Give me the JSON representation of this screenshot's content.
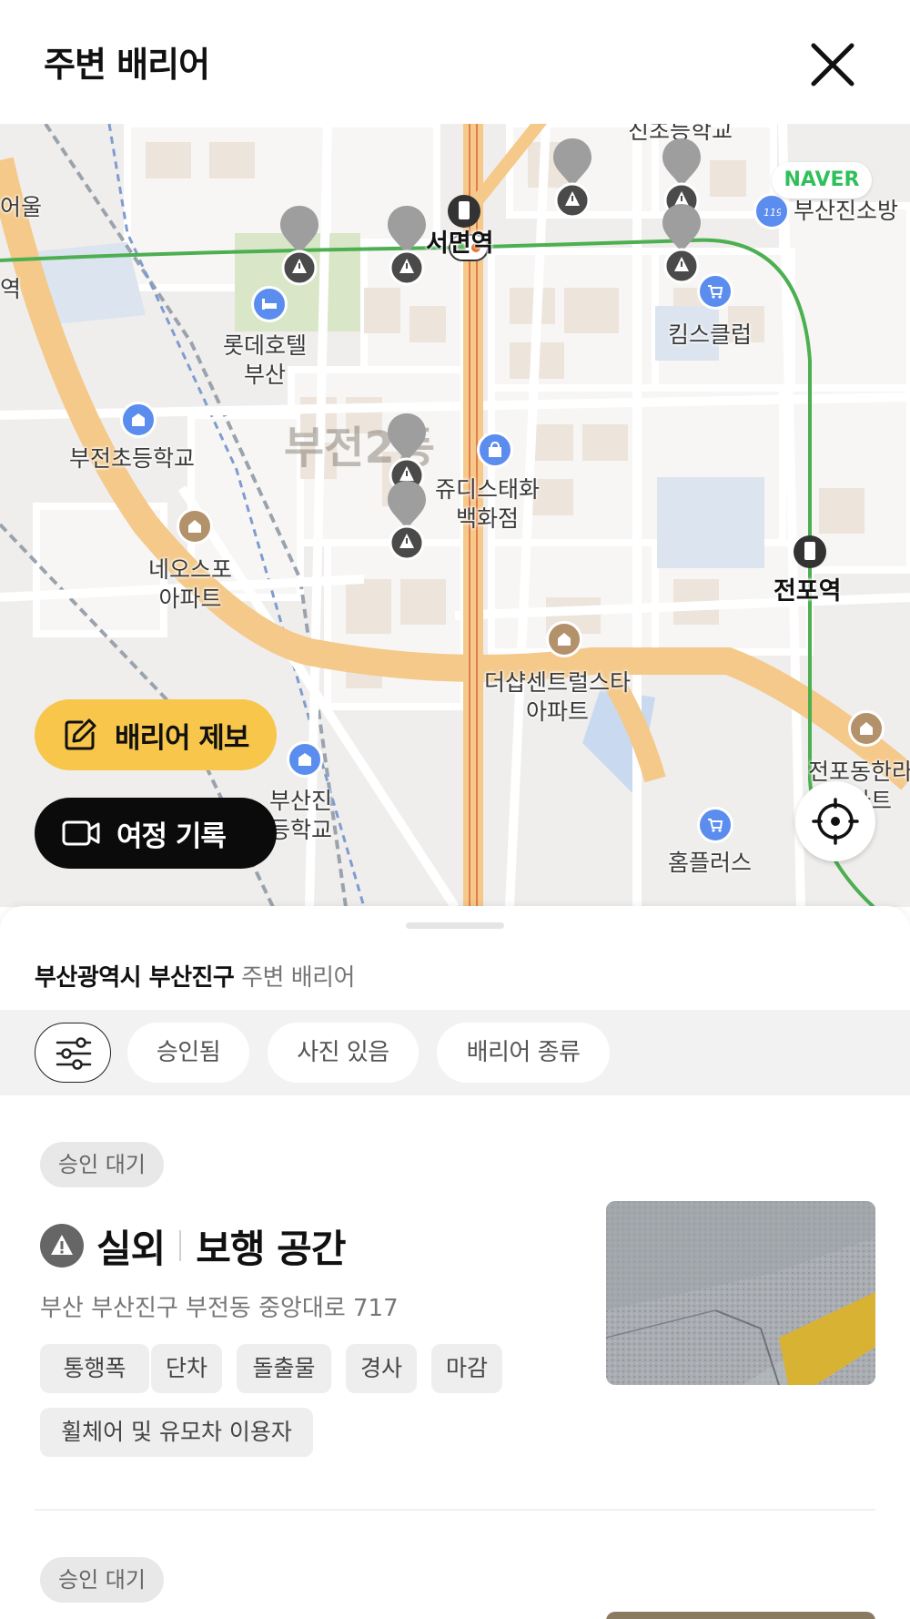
{
  "header": {
    "title": "주변 배리어"
  },
  "map": {
    "provider_badge": "NAVER",
    "labels": {
      "seomyeon_station": "서면역",
      "jeonpo_station": "전포역",
      "lotte_hotel": "롯데호텔\n부산",
      "bujeon_elem": "부전초등학교",
      "judies": "쥬디스태화\n백화점",
      "neos_apt": "네오스포\n아파트",
      "the_sharp": "더샵센트럴스타\n아파트",
      "kims_club": "킴스클럽",
      "busanjin_fire": "부산진소방",
      "busanjin_elem": "부산진\n등학교",
      "homeplus": "홈플러스",
      "jeonpo_dong": "전포동한라\n아파트",
      "bujeon_dong": "부전2동",
      "edge_station": "역",
      "edge_top": "진초등학교",
      "edge_left": "어울"
    },
    "report_button": "배리어 제보",
    "journey_button": "여정 기록"
  },
  "sheet": {
    "location_bold": "부산광역시 부산진구",
    "location_rest": " 주변 배리어",
    "filters": [
      "승인됨",
      "사진 있음",
      "배리어 종류"
    ],
    "cards": [
      {
        "status": "승인 대기",
        "category": "실외",
        "type": "보행 공간",
        "address": "부산 부산진구 부전동 중앙대로 717",
        "tags": [
          "통행폭",
          "단차",
          "돌출물",
          "경사",
          "마감",
          "휠체어 및 유모차 이용자"
        ]
      },
      {
        "status": "승인 대기"
      }
    ]
  },
  "colors": {
    "accent_yellow": "#f7c64a",
    "dark_button": "#0b0b0b",
    "pin_gray": "#9e9e9e",
    "poi_blue": "#5b8def",
    "poi_brown": "#b3926b",
    "subway_green": "#4caf50",
    "main_road": "#f4c98a"
  }
}
